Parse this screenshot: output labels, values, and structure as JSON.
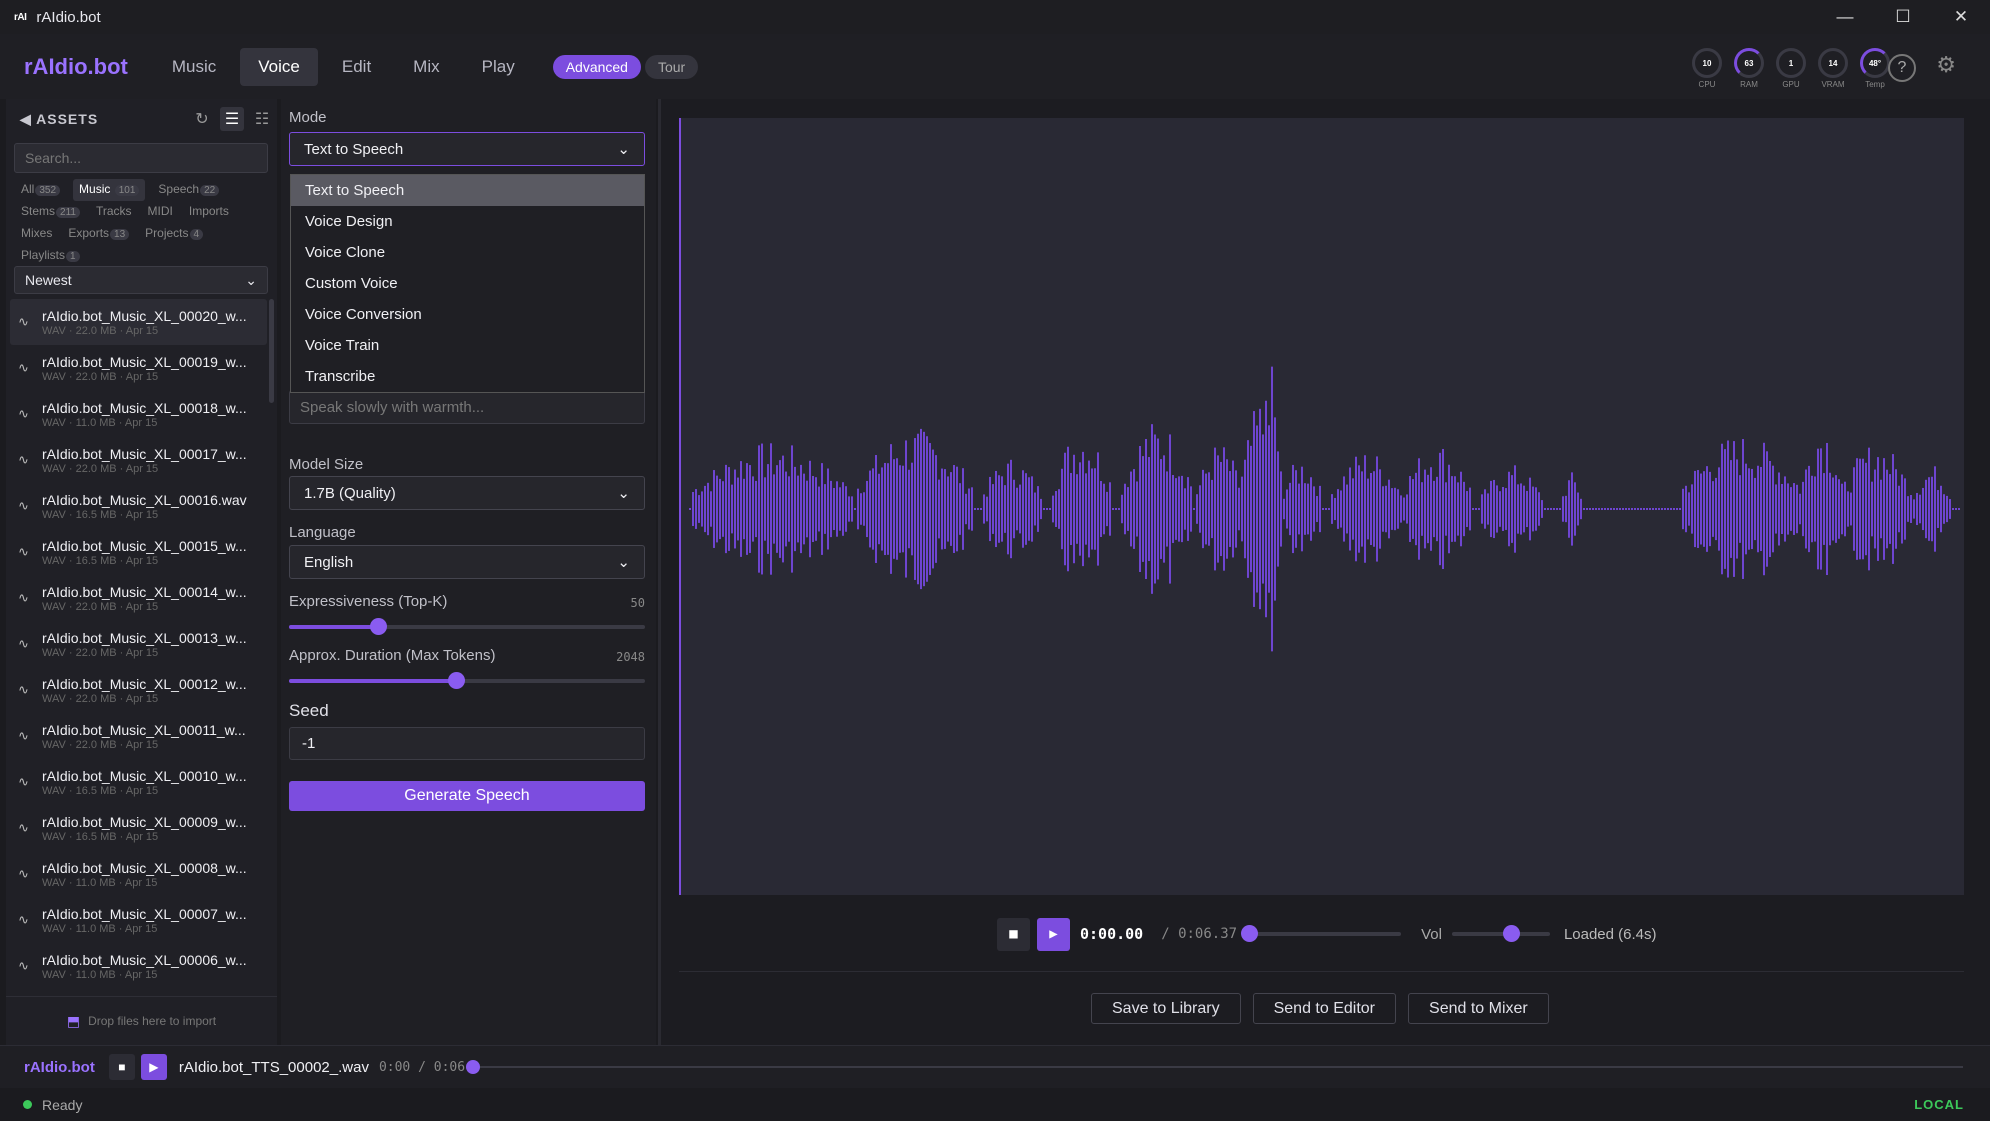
{
  "window": {
    "title": "rAIdio.bot",
    "icon_text": "rAI"
  },
  "nav": {
    "logo": "rAIdio.bot",
    "tabs": [
      {
        "label": "Music"
      },
      {
        "label": "Voice"
      },
      {
        "label": "Edit"
      },
      {
        "label": "Mix"
      },
      {
        "label": "Play"
      }
    ],
    "active_tab": "Voice",
    "advanced_label": "Advanced",
    "tour_label": "Tour",
    "gauges": [
      {
        "value": "10",
        "label": "CPU"
      },
      {
        "value": "63",
        "label": "RAM"
      },
      {
        "value": "1",
        "label": "GPU"
      },
      {
        "value": "14",
        "label": "VRAM"
      },
      {
        "value": "48°",
        "label": "Temp"
      }
    ],
    "help_label": "?"
  },
  "sidebar": {
    "header": "ASSETS",
    "search_placeholder": "Search...",
    "filters": [
      {
        "label": "All",
        "count": "352"
      },
      {
        "label": "Music",
        "count": "101"
      },
      {
        "label": "Speech",
        "count": "22"
      },
      {
        "label": "Stems",
        "count": "211"
      },
      {
        "label": "Tracks",
        "count": ""
      },
      {
        "label": "MIDI",
        "count": ""
      },
      {
        "label": "Imports",
        "count": ""
      },
      {
        "label": "Mixes",
        "count": ""
      },
      {
        "label": "Exports",
        "count": "13"
      },
      {
        "label": "Projects",
        "count": "4"
      },
      {
        "label": "Playlists",
        "count": "1"
      }
    ],
    "sort": "Newest",
    "files": [
      {
        "name": "rAIdio.bot_Music_XL_00020_w...",
        "meta": "WAV · 22.0 MB · Apr 15"
      },
      {
        "name": "rAIdio.bot_Music_XL_00019_w...",
        "meta": "WAV · 22.0 MB · Apr 15"
      },
      {
        "name": "rAIdio.bot_Music_XL_00018_w...",
        "meta": "WAV · 11.0 MB · Apr 15"
      },
      {
        "name": "rAIdio.bot_Music_XL_00017_w...",
        "meta": "WAV · 22.0 MB · Apr 15"
      },
      {
        "name": "rAIdio.bot_Music_XL_00016.wav",
        "meta": "WAV · 16.5 MB · Apr 15"
      },
      {
        "name": "rAIdio.bot_Music_XL_00015_w...",
        "meta": "WAV · 16.5 MB · Apr 15"
      },
      {
        "name": "rAIdio.bot_Music_XL_00014_w...",
        "meta": "WAV · 22.0 MB · Apr 15"
      },
      {
        "name": "rAIdio.bot_Music_XL_00013_w...",
        "meta": "WAV · 22.0 MB · Apr 15"
      },
      {
        "name": "rAIdio.bot_Music_XL_00012_w...",
        "meta": "WAV · 22.0 MB · Apr 15"
      },
      {
        "name": "rAIdio.bot_Music_XL_00011_w...",
        "meta": "WAV · 22.0 MB · Apr 15"
      },
      {
        "name": "rAIdio.bot_Music_XL_00010_w...",
        "meta": "WAV · 16.5 MB · Apr 15"
      },
      {
        "name": "rAIdio.bot_Music_XL_00009_w...",
        "meta": "WAV · 16.5 MB · Apr 15"
      },
      {
        "name": "rAIdio.bot_Music_XL_00008_w...",
        "meta": "WAV · 11.0 MB · Apr 15"
      },
      {
        "name": "rAIdio.bot_Music_XL_00007_w...",
        "meta": "WAV · 11.0 MB · Apr 15"
      },
      {
        "name": "rAIdio.bot_Music_XL_00006_w...",
        "meta": "WAV · 11.0 MB · Apr 15"
      }
    ],
    "drop_text": "Drop files here to import"
  },
  "form": {
    "mode_label": "Mode",
    "mode_value": "Text to Speech",
    "mode_options": [
      "Text to Speech",
      "Voice Design",
      "Voice Clone",
      "Custom Voice",
      "Voice Conversion",
      "Voice Train",
      "Transcribe"
    ],
    "instruction_placeholder": "Speak slowly with warmth...",
    "model_size_label": "Model Size",
    "model_size_value": "1.7B (Quality)",
    "language_label": "Language",
    "language_value": "English",
    "expressiveness_label": "Expressiveness (Top-K)",
    "expressiveness_value": "50",
    "expressiveness_fraction": 0.25,
    "duration_label": "Approx. Duration (Max Tokens)",
    "duration_value": "2048",
    "duration_fraction": 0.47,
    "seed_label": "Seed",
    "seed_value": "-1",
    "generate_label": "Generate Speech"
  },
  "player": {
    "current_time": "0:00.00",
    "total_time": "/ 0:06.37",
    "progress_fraction": 0,
    "vol_label": "Vol",
    "volume_fraction": 0.6,
    "status": "Loaded (6.4s)",
    "actions": [
      "Save to Library",
      "Send to Editor",
      "Send to Mixer"
    ],
    "wave_color": "#6e45d0"
  },
  "bottom": {
    "logo": "rAIdio.bot",
    "file_name": "rAIdio.bot_TTS_00002_.wav",
    "time": "0:00 / 0:06",
    "progress_fraction": 0
  },
  "status": {
    "text": "Ready",
    "mode": "LOCAL"
  },
  "colors": {
    "accent": "#7c4ddf",
    "ok": "#3cc95a",
    "bg": "#1b1b1f"
  }
}
